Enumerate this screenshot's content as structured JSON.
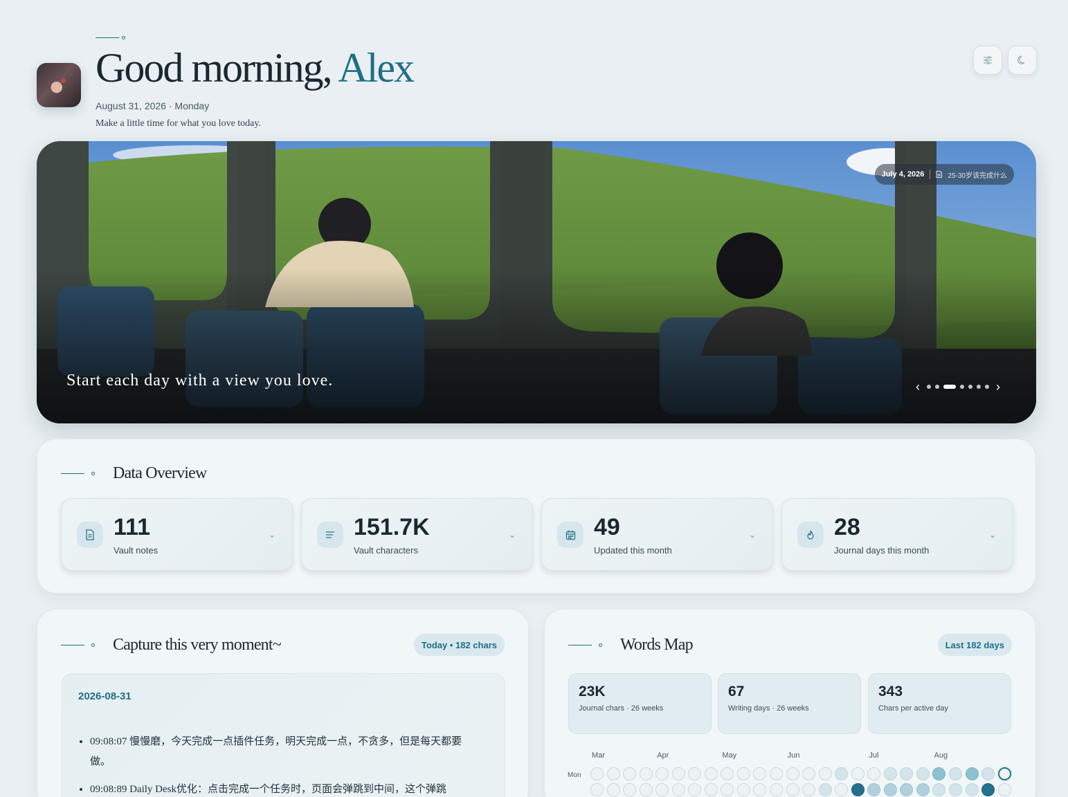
{
  "header": {
    "greeting_prefix": "Good morning,",
    "name": "Alex",
    "date": "August 31, 2026 · Monday",
    "subtitle": "Make a little time for what you love today.",
    "buttons": [
      {
        "icon": "sliders-icon"
      },
      {
        "icon": "moon-icon"
      }
    ]
  },
  "hero": {
    "chip_date": "July 4, 2026",
    "chip_note": "25-30岁该完成什么",
    "quote": "Start each day with a view you love.",
    "slide_count": 8,
    "active_slide": 3
  },
  "overview": {
    "title": "Data Overview",
    "stats": [
      {
        "value": "111",
        "label": "Vault notes",
        "icon": "document-icon"
      },
      {
        "value": "151.7K",
        "label": "Vault characters",
        "icon": "text-lines-icon"
      },
      {
        "value": "49",
        "label": "Updated this month",
        "icon": "calendar-icon"
      },
      {
        "value": "28",
        "label": "Journal days this month",
        "icon": "flame-icon"
      }
    ]
  },
  "capture": {
    "title": "Capture this very moment~",
    "badge": "Today • 182 chars",
    "entry_date": "2026-08-31",
    "items": [
      "09:08:07 慢慢磨，今天完成一点插件任务，明天完成一点，不贪多，但是每天都要做。",
      "09:08:89 Daily Desk优化：点击完成一个任务时，页面会弹跳到中间，这个弹跳"
    ]
  },
  "words_map": {
    "title": "Words Map",
    "badge": "Last 182 days",
    "stats": [
      {
        "value": "23K",
        "label": "Journal chars · 26 weeks"
      },
      {
        "value": "67",
        "label": "Writing days · 26 weeks"
      },
      {
        "value": "343",
        "label": "Chars per active day"
      }
    ],
    "months": [
      {
        "label": "Mar",
        "week": 0
      },
      {
        "label": "Apr",
        "week": 4
      },
      {
        "label": "May",
        "week": 8
      },
      {
        "label": "Jun",
        "week": 12
      },
      {
        "label": "Jul",
        "week": 17
      },
      {
        "label": "Aug",
        "week": 21
      }
    ],
    "day_label": "Mon",
    "rows": [
      [
        0,
        0,
        0,
        0,
        0,
        0,
        0,
        0,
        0,
        0,
        0,
        0,
        0,
        0,
        0,
        1,
        0,
        0,
        1,
        1,
        1,
        3,
        1,
        3,
        1,
        5
      ],
      [
        0,
        0,
        0,
        0,
        0,
        0,
        0,
        0,
        0,
        0,
        0,
        0,
        0,
        0,
        1,
        0,
        4,
        2,
        2,
        2,
        2,
        1,
        1,
        1,
        4,
        0
      ]
    ]
  },
  "colors": {
    "accent": "#1f6f86",
    "background": "#e9eff2",
    "panel": "#f1f6f8"
  }
}
